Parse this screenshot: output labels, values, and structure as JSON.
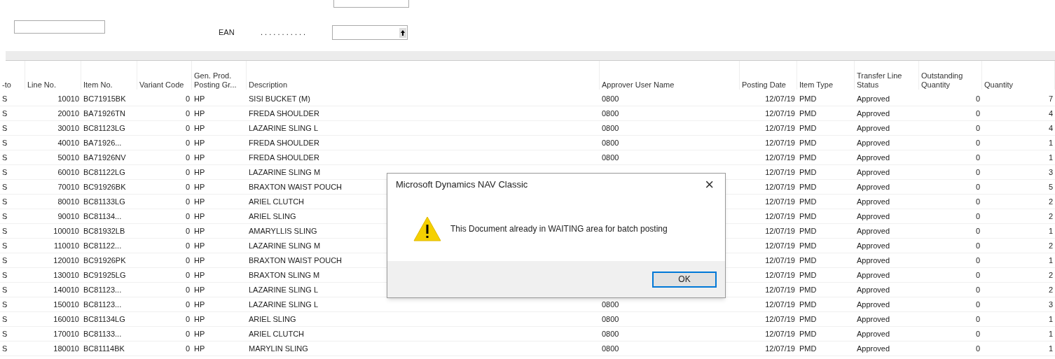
{
  "filters": {
    "ean": {
      "label": "EAN",
      "leader": ". . . . . . . . . . ."
    }
  },
  "table": {
    "columns": [
      "-to",
      "Line No.",
      "Item No.",
      "Variant Code",
      "Gen. Prod. Posting Gr...",
      "Description",
      "Approver User Name",
      "Posting Date",
      "Item Type",
      "Transfer Line Status",
      "Outstanding Quantity",
      "Quantity"
    ],
    "rows": [
      {
        "col0": "S",
        "line": "10010",
        "item": "BC71915BK",
        "variant": "0",
        "gen": "HP",
        "desc": "SISI BUCKET (M)",
        "approver": "0800",
        "date": "12/07/19",
        "type": "PMD",
        "status": "Approved",
        "outstanding": "0",
        "qty": "7"
      },
      {
        "col0": "S",
        "line": "20010",
        "item": "BA71926TN",
        "variant": "0",
        "gen": "HP",
        "desc": "FREDA SHOULDER",
        "approver": "0800",
        "date": "12/07/19",
        "type": "PMD",
        "status": "Approved",
        "outstanding": "0",
        "qty": "4"
      },
      {
        "col0": "S",
        "line": "30010",
        "item": "BC81123LG",
        "variant": "0",
        "gen": "HP",
        "desc": "LAZARINE SLING L",
        "approver": "0800",
        "date": "12/07/19",
        "type": "PMD",
        "status": "Approved",
        "outstanding": "0",
        "qty": "4"
      },
      {
        "col0": "S",
        "line": "40010",
        "item": "BA71926...",
        "variant": "0",
        "gen": "HP",
        "desc": "FREDA SHOULDER",
        "approver": "0800",
        "date": "12/07/19",
        "type": "PMD",
        "status": "Approved",
        "outstanding": "0",
        "qty": "1"
      },
      {
        "col0": "S",
        "line": "50010",
        "item": "BA71926NV",
        "variant": "0",
        "gen": "HP",
        "desc": "FREDA SHOULDER",
        "approver": "0800",
        "date": "12/07/19",
        "type": "PMD",
        "status": "Approved",
        "outstanding": "0",
        "qty": "1"
      },
      {
        "col0": "S",
        "line": "60010",
        "item": "BC81122LG",
        "variant": "0",
        "gen": "HP",
        "desc": "LAZARINE SLING M",
        "date": "12/07/19",
        "type": "PMD",
        "status": "Approved",
        "outstanding": "0",
        "qty": "3"
      },
      {
        "col0": "S",
        "line": "70010",
        "item": "BC91926BK",
        "variant": "0",
        "gen": "HP",
        "desc": "BRAXTON WAIST POUCH",
        "date": "12/07/19",
        "type": "PMD",
        "status": "Approved",
        "outstanding": "0",
        "qty": "5"
      },
      {
        "col0": "S",
        "line": "80010",
        "item": "BC81133LG",
        "variant": "0",
        "gen": "HP",
        "desc": "ARIEL CLUTCH",
        "date": "12/07/19",
        "type": "PMD",
        "status": "Approved",
        "outstanding": "0",
        "qty": "2"
      },
      {
        "col0": "S",
        "line": "90010",
        "item": "BC81134...",
        "variant": "0",
        "gen": "HP",
        "desc": "ARIEL SLING",
        "date": "12/07/19",
        "type": "PMD",
        "status": "Approved",
        "outstanding": "0",
        "qty": "2"
      },
      {
        "col0": "S",
        "line": "100010",
        "item": "BC81932LB",
        "variant": "0",
        "gen": "HP",
        "desc": "AMARYLLIS SLING",
        "date": "12/07/19",
        "type": "PMD",
        "status": "Approved",
        "outstanding": "0",
        "qty": "1"
      },
      {
        "col0": "S",
        "line": "110010",
        "item": "BC81122...",
        "variant": "0",
        "gen": "HP",
        "desc": "LAZARINE SLING M",
        "date": "12/07/19",
        "type": "PMD",
        "status": "Approved",
        "outstanding": "0",
        "qty": "2"
      },
      {
        "col0": "S",
        "line": "120010",
        "item": "BC91926PK",
        "variant": "0",
        "gen": "HP",
        "desc": "BRAXTON WAIST POUCH",
        "date": "12/07/19",
        "type": "PMD",
        "status": "Approved",
        "outstanding": "0",
        "qty": "1"
      },
      {
        "col0": "S",
        "line": "130010",
        "item": "BC91925LG",
        "variant": "0",
        "gen": "HP",
        "desc": "BRAXTON SLING M",
        "date": "12/07/19",
        "type": "PMD",
        "status": "Approved",
        "outstanding": "0",
        "qty": "2"
      },
      {
        "col0": "S",
        "line": "140010",
        "item": "BC81123...",
        "variant": "0",
        "gen": "HP",
        "desc": "LAZARINE SLING L",
        "date": "12/07/19",
        "type": "PMD",
        "status": "Approved",
        "outstanding": "0",
        "qty": "2"
      },
      {
        "col0": "S",
        "line": "150010",
        "item": "BC81123...",
        "variant": "0",
        "gen": "HP",
        "desc": "LAZARINE SLING L",
        "approver": "0800",
        "date": "12/07/19",
        "type": "PMD",
        "status": "Approved",
        "outstanding": "0",
        "qty": "3"
      },
      {
        "col0": "S",
        "line": "160010",
        "item": "BC81134LG",
        "variant": "0",
        "gen": "HP",
        "desc": "ARIEL SLING",
        "approver": "0800",
        "date": "12/07/19",
        "type": "PMD",
        "status": "Approved",
        "outstanding": "0",
        "qty": "1"
      },
      {
        "col0": "S",
        "line": "170010",
        "item": "BC81133...",
        "variant": "0",
        "gen": "HP",
        "desc": "ARIEL CLUTCH",
        "approver": "0800",
        "date": "12/07/19",
        "type": "PMD",
        "status": "Approved",
        "outstanding": "0",
        "qty": "1"
      },
      {
        "col0": "S",
        "line": "180010",
        "item": "BC81114BK",
        "variant": "0",
        "gen": "HP",
        "desc": "MARYLIN SLING",
        "approver": "0800",
        "date": "12/07/19",
        "type": "PMD",
        "status": "Approved",
        "outstanding": "0",
        "qty": "1"
      }
    ]
  },
  "dialog": {
    "title": "Microsoft Dynamics NAV Classic",
    "close": "×",
    "message": "This Document already in WAITING area for batch posting",
    "buttons": [
      "OK"
    ]
  }
}
